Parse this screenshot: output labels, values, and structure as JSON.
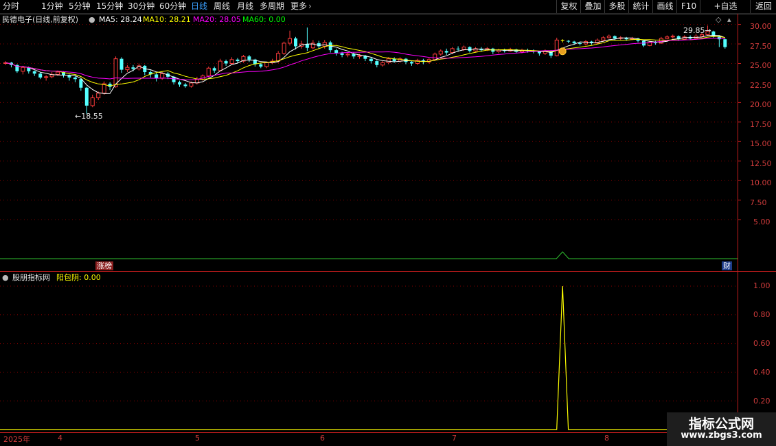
{
  "toolbar": {
    "periods": [
      "分时",
      "1分钟",
      "5分钟",
      "15分钟",
      "30分钟",
      "60分钟",
      "日线",
      "周线",
      "月线",
      "多周期",
      "更多"
    ],
    "active_period": "日线",
    "right_buttons": [
      "复权",
      "叠加",
      "多股",
      "统计",
      "画线",
      "F10",
      "+自选",
      "返回"
    ]
  },
  "main_chart": {
    "stock_name": "民德电子",
    "mode": "(日线,前复权)",
    "ma5": "MA5: 28.24",
    "ma10": "MA10: 28.21",
    "ma20": "MA20: 28.05",
    "ma60": "MA60: 0.00",
    "low_label": "18.55",
    "high_label": "29.85",
    "y_ticks": [
      "30.00",
      "27.50",
      "25.00",
      "22.50",
      "20.00",
      "17.50",
      "15.00",
      "12.50",
      "10.00",
      "7.50",
      "5.00"
    ],
    "tag_left": "涨榜",
    "tag_right": "财"
  },
  "indicator": {
    "source_name": "股朋指标网",
    "name": "阳包阴: 0.00",
    "y_ticks": [
      "1.00",
      "0.80",
      "0.60",
      "0.40",
      "0.20"
    ]
  },
  "x_axis": {
    "labels": [
      "2025年",
      "4",
      "5",
      "6",
      "7",
      "8"
    ]
  },
  "watermark": {
    "title": "指标公式网",
    "url": "www.zbgs3.com"
  },
  "colors": {
    "up": "#ff3c3c",
    "down": "#54ffff",
    "ma5": "#ffffff",
    "ma10": "#ffff00",
    "ma20": "#ff00ff",
    "ma60": "#00ff00",
    "axis": "#c81e1e",
    "grid": "#8b0000",
    "signal": "#ffff00"
  },
  "chart_data": {
    "type": "candlestick",
    "y_range": [
      0,
      31.2
    ],
    "candles": [
      [
        25.0,
        25.1,
        25.3,
        24.8
      ],
      [
        25.1,
        24.8,
        25.2,
        24.5
      ],
      [
        24.8,
        24.0,
        24.9,
        23.8
      ],
      [
        24.0,
        24.5,
        24.7,
        23.6
      ],
      [
        24.5,
        24.0,
        24.6,
        23.7
      ],
      [
        24.0,
        23.7,
        24.1,
        23.4
      ],
      [
        23.7,
        23.2,
        23.9,
        23.0
      ],
      [
        23.2,
        23.3,
        23.5,
        22.8
      ],
      [
        23.3,
        23.6,
        23.9,
        23.1
      ],
      [
        23.6,
        23.9,
        24.1,
        23.4
      ],
      [
        23.9,
        23.5,
        24.0,
        23.2
      ],
      [
        23.5,
        23.2,
        23.6,
        22.8
      ],
      [
        23.2,
        23.0,
        23.4,
        22.6
      ],
      [
        23.0,
        21.9,
        23.1,
        21.5
      ],
      [
        21.9,
        19.6,
        22.0,
        18.55
      ],
      [
        19.6,
        20.6,
        21.0,
        19.4
      ],
      [
        20.6,
        21.2,
        21.4,
        20.3
      ],
      [
        21.2,
        22.4,
        22.7,
        21.0
      ],
      [
        22.4,
        22.0,
        22.6,
        21.6
      ],
      [
        22.0,
        25.6,
        25.9,
        21.9
      ],
      [
        25.6,
        24.2,
        25.8,
        23.8
      ],
      [
        24.2,
        24.5,
        24.8,
        23.9
      ],
      [
        24.5,
        24.3,
        24.8,
        24.0
      ],
      [
        24.3,
        24.7,
        25.0,
        24.1
      ],
      [
        24.7,
        23.9,
        24.8,
        23.5
      ],
      [
        23.9,
        23.6,
        24.1,
        23.2
      ],
      [
        23.6,
        23.1,
        23.8,
        22.7
      ],
      [
        23.1,
        23.7,
        23.9,
        22.9
      ],
      [
        23.7,
        23.3,
        23.9,
        23.0
      ],
      [
        23.3,
        22.6,
        23.4,
        22.3
      ],
      [
        22.6,
        22.3,
        22.8,
        22.0
      ],
      [
        22.3,
        22.1,
        22.5,
        21.9
      ],
      [
        22.1,
        22.5,
        22.7,
        21.9
      ],
      [
        22.5,
        23.0,
        23.3,
        22.3
      ],
      [
        23.0,
        23.4,
        23.6,
        22.8
      ],
      [
        23.4,
        24.4,
        24.6,
        23.2
      ],
      [
        24.4,
        24.1,
        24.6,
        23.8
      ],
      [
        24.1,
        25.3,
        25.6,
        24.0
      ],
      [
        25.3,
        25.0,
        25.5,
        24.7
      ],
      [
        25.0,
        25.5,
        25.8,
        24.8
      ],
      [
        25.5,
        25.3,
        25.7,
        25.0
      ],
      [
        25.3,
        25.9,
        26.1,
        25.1
      ],
      [
        25.9,
        25.5,
        26.1,
        25.2
      ],
      [
        25.5,
        24.9,
        25.6,
        24.6
      ],
      [
        24.9,
        24.6,
        25.1,
        24.4
      ],
      [
        24.6,
        25.1,
        25.2,
        24.4
      ],
      [
        25.1,
        25.3,
        25.6,
        24.9
      ],
      [
        25.3,
        26.3,
        26.6,
        25.1
      ],
      [
        26.3,
        27.6,
        27.8,
        26.1
      ],
      [
        27.6,
        28.2,
        29.2,
        27.3
      ],
      [
        28.2,
        27.2,
        28.4,
        26.8
      ],
      [
        27.2,
        27.5,
        27.9,
        26.9
      ],
      [
        27.5,
        27.0,
        29.6,
        26.6
      ],
      [
        27.0,
        27.6,
        28.0,
        26.8
      ],
      [
        27.6,
        27.2,
        27.9,
        26.9
      ],
      [
        27.2,
        27.7,
        28.0,
        26.9
      ],
      [
        27.7,
        26.7,
        27.9,
        26.4
      ],
      [
        26.7,
        26.3,
        26.9,
        26.0
      ],
      [
        26.3,
        26.1,
        26.5,
        25.8
      ],
      [
        26.1,
        26.2,
        26.4,
        25.8
      ],
      [
        26.2,
        25.9,
        26.4,
        25.6
      ],
      [
        25.9,
        26.0,
        26.2,
        25.6
      ],
      [
        26.0,
        25.6,
        26.1,
        25.3
      ],
      [
        25.6,
        25.3,
        25.8,
        25.0
      ],
      [
        25.3,
        24.8,
        25.4,
        24.5
      ],
      [
        24.8,
        25.1,
        25.3,
        24.6
      ],
      [
        25.1,
        25.6,
        25.8,
        24.9
      ],
      [
        25.6,
        25.3,
        25.8,
        25.1
      ],
      [
        25.3,
        25.6,
        25.8,
        25.1
      ],
      [
        25.6,
        25.2,
        25.7,
        24.9
      ],
      [
        25.2,
        25.0,
        25.3,
        24.7
      ],
      [
        25.0,
        25.4,
        25.6,
        24.8
      ],
      [
        25.4,
        25.2,
        25.6,
        24.9
      ],
      [
        25.2,
        25.5,
        25.7,
        25.0
      ],
      [
        25.5,
        26.2,
        26.4,
        25.3
      ],
      [
        26.2,
        26.6,
        26.8,
        26.0
      ],
      [
        26.6,
        26.4,
        26.9,
        26.1
      ],
      [
        26.4,
        26.9,
        27.1,
        26.2
      ],
      [
        26.9,
        26.8,
        27.2,
        26.5
      ],
      [
        26.8,
        27.1,
        27.3,
        26.6
      ],
      [
        27.1,
        26.6,
        27.2,
        26.4
      ],
      [
        26.6,
        26.9,
        27.1,
        26.5
      ],
      [
        26.9,
        26.7,
        27.1,
        26.5
      ],
      [
        26.7,
        26.9,
        27.1,
        26.6
      ],
      [
        26.9,
        26.5,
        27.0,
        26.2
      ],
      [
        26.5,
        26.7,
        26.9,
        26.3
      ],
      [
        26.7,
        26.6,
        26.9,
        26.4
      ],
      [
        26.6,
        26.8,
        27.0,
        26.5
      ],
      [
        26.8,
        26.5,
        26.9,
        26.3
      ],
      [
        26.5,
        26.7,
        26.9,
        26.3
      ],
      [
        26.7,
        26.6,
        26.9,
        26.4
      ],
      [
        26.6,
        26.5,
        26.8,
        26.3
      ],
      [
        26.5,
        26.3,
        26.6,
        26.0
      ],
      [
        26.3,
        26.6,
        26.8,
        26.1
      ],
      [
        26.6,
        26.0,
        26.7,
        25.7
      ],
      [
        26.0,
        28.0,
        28.3,
        25.9
      ],
      [
        28.0,
        27.9,
        28.1,
        27.7
      ],
      [
        27.9,
        27.8,
        28.0,
        27.6
      ],
      [
        27.8,
        27.6,
        27.9,
        27.4
      ],
      [
        27.6,
        27.5,
        27.8,
        27.3
      ],
      [
        27.5,
        27.8,
        28.0,
        27.3
      ],
      [
        27.8,
        27.6,
        27.9,
        27.4
      ],
      [
        27.6,
        28.0,
        28.2,
        27.5
      ],
      [
        28.0,
        28.3,
        28.5,
        27.9
      ],
      [
        28.3,
        28.5,
        28.7,
        28.2
      ],
      [
        28.5,
        28.2,
        28.6,
        28.0
      ],
      [
        28.2,
        28.3,
        28.5,
        28.0
      ],
      [
        28.3,
        28.1,
        28.4,
        27.9
      ],
      [
        28.1,
        28.2,
        28.4,
        28.0
      ],
      [
        28.2,
        27.9,
        28.3,
        27.7
      ],
      [
        27.9,
        27.3,
        28.0,
        27.1
      ],
      [
        27.3,
        27.7,
        27.9,
        27.2
      ],
      [
        27.7,
        27.6,
        27.9,
        27.4
      ],
      [
        27.6,
        28.2,
        28.4,
        27.5
      ],
      [
        28.2,
        28.4,
        28.6,
        28.1
      ],
      [
        28.4,
        28.5,
        28.7,
        28.2
      ],
      [
        28.5,
        28.1,
        28.6,
        27.9
      ],
      [
        28.1,
        28.4,
        28.6,
        28.0
      ],
      [
        28.4,
        28.2,
        28.6,
        28.0
      ],
      [
        28.2,
        28.5,
        28.8,
        28.1
      ],
      [
        28.5,
        28.7,
        28.9,
        28.4
      ],
      [
        28.7,
        29.1,
        29.85,
        28.6
      ],
      [
        29.1,
        28.5,
        29.2,
        28.3
      ],
      [
        28.5,
        28.1,
        28.6,
        27.1
      ],
      [
        28.1,
        27.1,
        28.2,
        26.9
      ]
    ],
    "signal_index": 96,
    "signal_values": "0 everywhere except 1 at signal_index"
  }
}
